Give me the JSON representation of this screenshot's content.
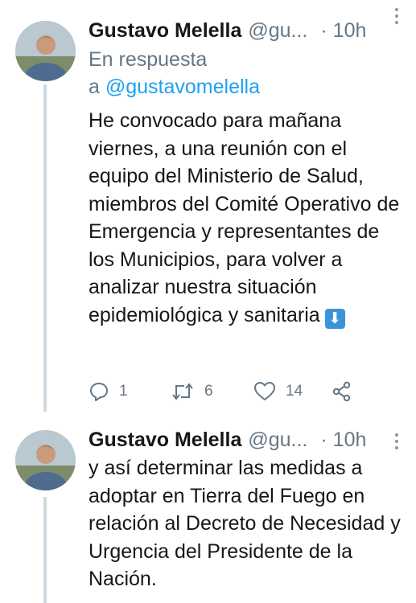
{
  "tweets": [
    {
      "author_name": "Gustavo Melella",
      "author_handle": "@gu...",
      "time": "· 10h",
      "replying_prefix": "En respuesta",
      "replying_line2_prefix": "a ",
      "replying_to": "@gustavomelella",
      "text": "He convocado para mañana viernes, a una reunión con el equipo del Ministerio de Salud, miembros del Comité Operativo de Emergencia y representantes de los Municipios, para volver a analizar nuestra situación epidemiológica y sanitaria",
      "emoji": "⬇",
      "actions": {
        "reply_count": "1",
        "retweet_count": "6",
        "like_count": "14"
      }
    },
    {
      "author_name": "Gustavo Melella",
      "author_handle": "@gu...",
      "time": "· 10h",
      "text": "y así determinar las medidas a adoptar en Tierra del Fuego en relación al Decreto de Necesidad y Urgencia del Presidente de la Nación."
    }
  ],
  "icons": {
    "reply": "reply-icon",
    "retweet": "retweet-icon",
    "like": "heart-icon",
    "share": "share-icon",
    "more": "more-vertical-icon",
    "emoji": "down-arrow-emoji-icon"
  },
  "colors": {
    "text": "#14171a",
    "secondary": "#657786",
    "link": "#1da1f2",
    "thread_line": "#cfd9de",
    "emoji_bg": "#3b94d9"
  }
}
